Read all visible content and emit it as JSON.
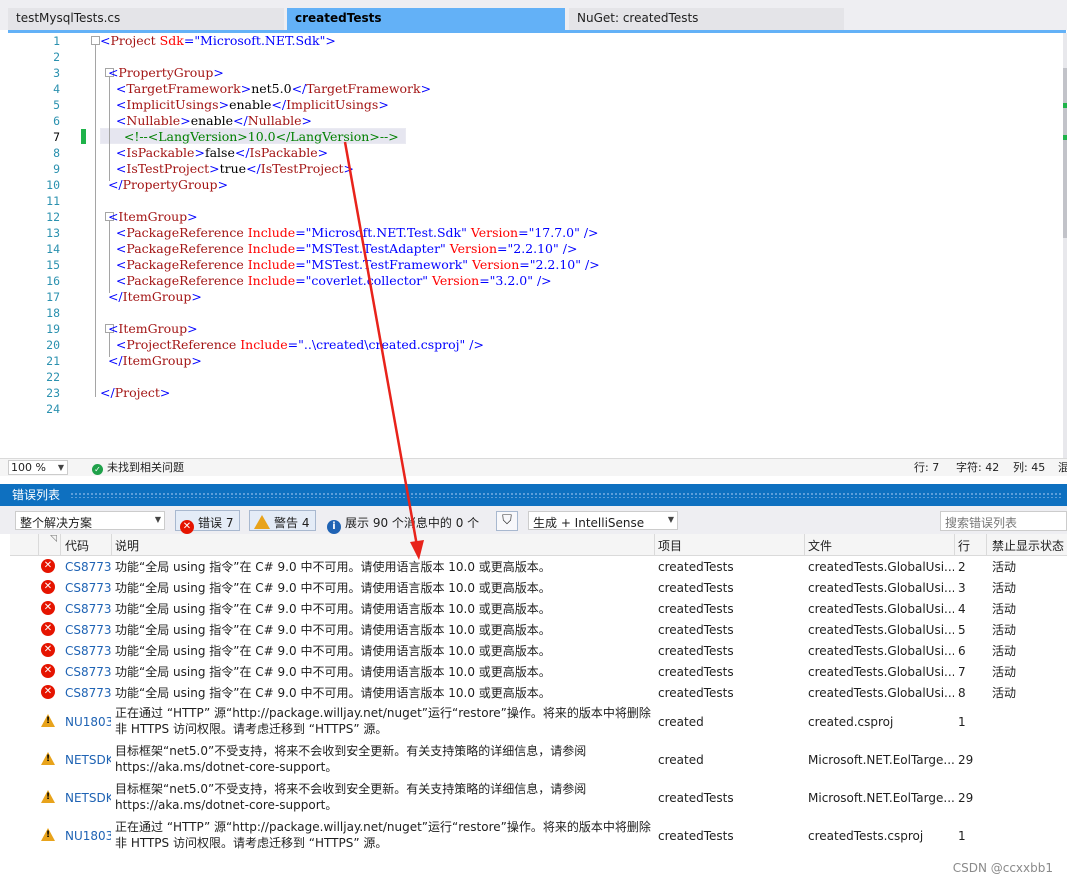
{
  "tabs": [
    {
      "label": "testMysqlTests.cs",
      "active": false
    },
    {
      "label": "createdTests",
      "active": true
    },
    {
      "label": "NuGet: createdTests",
      "active": false
    }
  ],
  "editor": {
    "line_numbers": [
      "1",
      "2",
      "3",
      "4",
      "5",
      "6",
      "7",
      "8",
      "9",
      "10",
      "11",
      "12",
      "13",
      "14",
      "15",
      "16",
      "17",
      "18",
      "19",
      "20",
      "21",
      "22",
      "23",
      "24"
    ],
    "lines": [
      [
        {
          "t": "<",
          "c": "b"
        },
        {
          "t": "Project",
          "c": "m"
        },
        {
          "t": " Sdk",
          "c": "a"
        },
        {
          "t": "=",
          "c": "b"
        },
        {
          "t": "\"Microsoft.NET.Sdk\"",
          "c": "s"
        },
        {
          "t": ">",
          "c": "b"
        }
      ],
      [],
      [
        {
          "t": "  <",
          "c": "b"
        },
        {
          "t": "PropertyGroup",
          "c": "m"
        },
        {
          "t": ">",
          "c": "b"
        }
      ],
      [
        {
          "t": "    <",
          "c": "b"
        },
        {
          "t": "TargetFramework",
          "c": "m"
        },
        {
          "t": ">",
          "c": "b"
        },
        {
          "t": "net5.0",
          "c": "x"
        },
        {
          "t": "</",
          "c": "b"
        },
        {
          "t": "TargetFramework",
          "c": "m"
        },
        {
          "t": ">",
          "c": "b"
        }
      ],
      [
        {
          "t": "    <",
          "c": "b"
        },
        {
          "t": "ImplicitUsings",
          "c": "m"
        },
        {
          "t": ">",
          "c": "b"
        },
        {
          "t": "enable",
          "c": "x"
        },
        {
          "t": "</",
          "c": "b"
        },
        {
          "t": "ImplicitUsings",
          "c": "m"
        },
        {
          "t": ">",
          "c": "b"
        }
      ],
      [
        {
          "t": "    <",
          "c": "b"
        },
        {
          "t": "Nullable",
          "c": "m"
        },
        {
          "t": ">",
          "c": "b"
        },
        {
          "t": "enable",
          "c": "x"
        },
        {
          "t": "</",
          "c": "b"
        },
        {
          "t": "Nullable",
          "c": "m"
        },
        {
          "t": ">",
          "c": "b"
        }
      ],
      [
        {
          "t": "      <!--<LangVersion>10.0</LangVersion>-->",
          "c": "c"
        }
      ],
      [
        {
          "t": "    <",
          "c": "b"
        },
        {
          "t": "IsPackable",
          "c": "m"
        },
        {
          "t": ">",
          "c": "b"
        },
        {
          "t": "false",
          "c": "x"
        },
        {
          "t": "</",
          "c": "b"
        },
        {
          "t": "IsPackable",
          "c": "m"
        },
        {
          "t": ">",
          "c": "b"
        }
      ],
      [
        {
          "t": "    <",
          "c": "b"
        },
        {
          "t": "IsTestProject",
          "c": "m"
        },
        {
          "t": ">",
          "c": "b"
        },
        {
          "t": "true",
          "c": "x"
        },
        {
          "t": "</",
          "c": "b"
        },
        {
          "t": "IsTestProject",
          "c": "m"
        },
        {
          "t": ">",
          "c": "b"
        }
      ],
      [
        {
          "t": "  </",
          "c": "b"
        },
        {
          "t": "PropertyGroup",
          "c": "m"
        },
        {
          "t": ">",
          "c": "b"
        }
      ],
      [],
      [
        {
          "t": "  <",
          "c": "b"
        },
        {
          "t": "ItemGroup",
          "c": "m"
        },
        {
          "t": ">",
          "c": "b"
        }
      ],
      [
        {
          "t": "    <",
          "c": "b"
        },
        {
          "t": "PackageReference",
          "c": "m"
        },
        {
          "t": " Include",
          "c": "a"
        },
        {
          "t": "=",
          "c": "b"
        },
        {
          "t": "\"Microsoft.NET.Test.Sdk\"",
          "c": "s"
        },
        {
          "t": " Version",
          "c": "a"
        },
        {
          "t": "=",
          "c": "b"
        },
        {
          "t": "\"17.7.0\"",
          "c": "s"
        },
        {
          "t": " />",
          "c": "b"
        }
      ],
      [
        {
          "t": "    <",
          "c": "b"
        },
        {
          "t": "PackageReference",
          "c": "m"
        },
        {
          "t": " Include",
          "c": "a"
        },
        {
          "t": "=",
          "c": "b"
        },
        {
          "t": "\"MSTest.TestAdapter\"",
          "c": "s"
        },
        {
          "t": " Version",
          "c": "a"
        },
        {
          "t": "=",
          "c": "b"
        },
        {
          "t": "\"2.2.10\"",
          "c": "s"
        },
        {
          "t": " />",
          "c": "b"
        }
      ],
      [
        {
          "t": "    <",
          "c": "b"
        },
        {
          "t": "PackageReference",
          "c": "m"
        },
        {
          "t": " Include",
          "c": "a"
        },
        {
          "t": "=",
          "c": "b"
        },
        {
          "t": "\"MSTest.TestFramework\"",
          "c": "s"
        },
        {
          "t": " Version",
          "c": "a"
        },
        {
          "t": "=",
          "c": "b"
        },
        {
          "t": "\"2.2.10\"",
          "c": "s"
        },
        {
          "t": " />",
          "c": "b"
        }
      ],
      [
        {
          "t": "    <",
          "c": "b"
        },
        {
          "t": "PackageReference",
          "c": "m"
        },
        {
          "t": " Include",
          "c": "a"
        },
        {
          "t": "=",
          "c": "b"
        },
        {
          "t": "\"coverlet.collector\"",
          "c": "s"
        },
        {
          "t": " Version",
          "c": "a"
        },
        {
          "t": "=",
          "c": "b"
        },
        {
          "t": "\"3.2.0\"",
          "c": "s"
        },
        {
          "t": " />",
          "c": "b"
        }
      ],
      [
        {
          "t": "  </",
          "c": "b"
        },
        {
          "t": "ItemGroup",
          "c": "m"
        },
        {
          "t": ">",
          "c": "b"
        }
      ],
      [],
      [
        {
          "t": "  <",
          "c": "b"
        },
        {
          "t": "ItemGroup",
          "c": "m"
        },
        {
          "t": ">",
          "c": "b"
        }
      ],
      [
        {
          "t": "    <",
          "c": "b"
        },
        {
          "t": "ProjectReference",
          "c": "m"
        },
        {
          "t": " Include",
          "c": "a"
        },
        {
          "t": "=",
          "c": "b"
        },
        {
          "t": "\"..\\created\\created.csproj\"",
          "c": "s"
        },
        {
          "t": " />",
          "c": "b"
        }
      ],
      [
        {
          "t": "  </",
          "c": "b"
        },
        {
          "t": "ItemGroup",
          "c": "m"
        },
        {
          "t": ">",
          "c": "b"
        }
      ],
      [],
      [
        {
          "t": "</",
          "c": "b"
        },
        {
          "t": "Project",
          "c": "m"
        },
        {
          "t": ">",
          "c": "b"
        }
      ],
      []
    ]
  },
  "statusbar": {
    "zoom": "100 %",
    "issues": "未找到相关问题",
    "line": "行: 7",
    "char": "字符: 42",
    "col": "列: 45",
    "extra": "混"
  },
  "panel": {
    "title": "错误列表",
    "scope": "整个解决方案",
    "errors_btn": "错误 7",
    "warnings_btn": "警告 4",
    "messages_btn": "展示 90 个消息中的 0 个",
    "build_filter": "生成 + IntelliSense",
    "search_placeholder": "搜索错误列表"
  },
  "table": {
    "headers": [
      "代码",
      "说明",
      "项目",
      "文件",
      "行",
      "禁止显示状态"
    ],
    "rows": [
      {
        "type": "error",
        "code": "CS8773",
        "desc": "功能“全局 using 指令”在 C# 9.0 中不可用。请使用语言版本 10.0 或更高版本。",
        "project": "createdTests",
        "file": "createdTests.GlobalUsi...",
        "line": "2",
        "state": "活动"
      },
      {
        "type": "error",
        "code": "CS8773",
        "desc": "功能“全局 using 指令”在 C# 9.0 中不可用。请使用语言版本 10.0 或更高版本。",
        "project": "createdTests",
        "file": "createdTests.GlobalUsi...",
        "line": "3",
        "state": "活动"
      },
      {
        "type": "error",
        "code": "CS8773",
        "desc": "功能“全局 using 指令”在 C# 9.0 中不可用。请使用语言版本 10.0 或更高版本。",
        "project": "createdTests",
        "file": "createdTests.GlobalUsi...",
        "line": "4",
        "state": "活动"
      },
      {
        "type": "error",
        "code": "CS8773",
        "desc": "功能“全局 using 指令”在 C# 9.0 中不可用。请使用语言版本 10.0 或更高版本。",
        "project": "createdTests",
        "file": "createdTests.GlobalUsi...",
        "line": "5",
        "state": "活动"
      },
      {
        "type": "error",
        "code": "CS8773",
        "desc": "功能“全局 using 指令”在 C# 9.0 中不可用。请使用语言版本 10.0 或更高版本。",
        "project": "createdTests",
        "file": "createdTests.GlobalUsi...",
        "line": "6",
        "state": "活动"
      },
      {
        "type": "error",
        "code": "CS8773",
        "desc": "功能“全局 using 指令”在 C# 9.0 中不可用。请使用语言版本 10.0 或更高版本。",
        "project": "createdTests",
        "file": "createdTests.GlobalUsi...",
        "line": "7",
        "state": "活动"
      },
      {
        "type": "error",
        "code": "CS8773",
        "desc": "功能“全局 using 指令”在 C# 9.0 中不可用。请使用语言版本 10.0 或更高版本。",
        "project": "createdTests",
        "file": "createdTests.GlobalUsi...",
        "line": "8",
        "state": "活动"
      },
      {
        "type": "warning",
        "code": "NU1803",
        "desc": "正在通过 “HTTP” 源“http://package.willjay.net/nuget”运行“restore”操作。将来的版本中将删除非 HTTPS 访问权限。请考虑迁移到 “HTTPS” 源。",
        "project": "created",
        "file": "created.csproj",
        "line": "1",
        "state": ""
      },
      {
        "type": "warning",
        "code": "NETSDK",
        "desc": "目标框架“net5.0”不受支持，将来不会收到安全更新。有关支持策略的详细信息，请参阅 https://aka.ms/dotnet-core-support。",
        "project": "created",
        "file": "Microsoft.NET.EolTarge...",
        "line": "29",
        "state": ""
      },
      {
        "type": "warning",
        "code": "NETSDK",
        "desc": "目标框架“net5.0”不受支持，将来不会收到安全更新。有关支持策略的详细信息，请参阅 https://aka.ms/dotnet-core-support。",
        "project": "createdTests",
        "file": "Microsoft.NET.EolTarge...",
        "line": "29",
        "state": ""
      },
      {
        "type": "warning",
        "code": "NU1803",
        "desc": "正在通过 “HTTP” 源“http://package.willjay.net/nuget”运行“restore”操作。将来的版本中将删除非 HTTPS 访问权限。请考虑迁移到 “HTTPS” 源。",
        "project": "createdTests",
        "file": "createdTests.csproj",
        "line": "1",
        "state": ""
      }
    ]
  },
  "watermark": "CSDN @ccxxbb1",
  "colors": {
    "tab_active": "#63b1f7",
    "panel_header": "#0e70c0",
    "error": "#e51400",
    "warning": "#e8a31b",
    "arrow": "#e8231b"
  }
}
